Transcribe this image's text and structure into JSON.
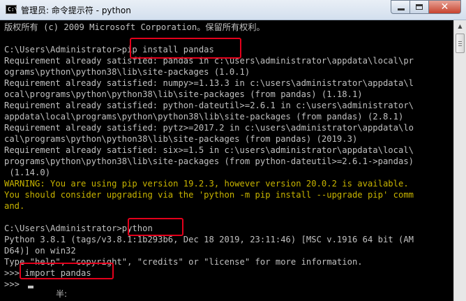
{
  "window": {
    "title": "管理员: 命令提示符 - python",
    "icon_label": "C:\\",
    "close_symbol": "✕",
    "icon": "cmd-prompt-icon"
  },
  "colors": {
    "console_bg": "#000000",
    "console_text": "#c0c0c0",
    "warning_text": "#c8b400",
    "highlight": "#e3001b"
  },
  "console": {
    "lines": [
      {
        "text": "版权所有 (c) 2009 Microsoft Corporation。保留所有权利。",
        "kind": "normal"
      },
      {
        "text": "",
        "kind": "normal"
      },
      {
        "text": "C:\\Users\\Administrator>pip install pandas",
        "kind": "normal"
      },
      {
        "text": "Requirement already satisfied: pandas in c:\\users\\administrator\\appdata\\local\\pr",
        "kind": "normal"
      },
      {
        "text": "ograms\\python\\python38\\lib\\site-packages (1.0.1)",
        "kind": "normal"
      },
      {
        "text": "Requirement already satisfied: numpy>=1.13.3 in c:\\users\\administrator\\appdata\\l",
        "kind": "normal"
      },
      {
        "text": "ocal\\programs\\python\\python38\\lib\\site-packages (from pandas) (1.18.1)",
        "kind": "normal"
      },
      {
        "text": "Requirement already satisfied: python-dateutil>=2.6.1 in c:\\users\\administrator\\",
        "kind": "normal"
      },
      {
        "text": "appdata\\local\\programs\\python\\python38\\lib\\site-packages (from pandas) (2.8.1)",
        "kind": "normal"
      },
      {
        "text": "Requirement already satisfied: pytz>=2017.2 in c:\\users\\administrator\\appdata\\lo",
        "kind": "normal"
      },
      {
        "text": "cal\\programs\\python\\python38\\lib\\site-packages (from pandas) (2019.3)",
        "kind": "normal"
      },
      {
        "text": "Requirement already satisfied: six>=1.5 in c:\\users\\administrator\\appdata\\local\\",
        "kind": "normal"
      },
      {
        "text": "programs\\python\\python38\\lib\\site-packages (from python-dateutil>=2.6.1->pandas)",
        "kind": "normal"
      },
      {
        "text": " (1.14.0)",
        "kind": "normal"
      },
      {
        "text": "WARNING: You are using pip version 19.2.3, however version 20.0.2 is available.",
        "kind": "warn"
      },
      {
        "text": "You should consider upgrading via the 'python -m pip install --upgrade pip' comm",
        "kind": "warn"
      },
      {
        "text": "and.",
        "kind": "warn"
      },
      {
        "text": "",
        "kind": "normal"
      },
      {
        "text": "C:\\Users\\Administrator>python",
        "kind": "normal"
      },
      {
        "text": "Python 3.8.1 (tags/v3.8.1:1b293b6, Dec 18 2019, 23:11:46) [MSC v.1916 64 bit (AM",
        "kind": "normal"
      },
      {
        "text": "D64)] on win32",
        "kind": "normal"
      },
      {
        "text": "Type \"help\", \"copyright\", \"credits\" or \"license\" for more information.",
        "kind": "normal"
      },
      {
        "text": ">>> import pandas",
        "kind": "normal"
      },
      {
        "text": ">>> ",
        "kind": "normal"
      }
    ],
    "ime_indicator": "半:"
  },
  "scrollbar": {
    "up_arrow": "▲"
  }
}
